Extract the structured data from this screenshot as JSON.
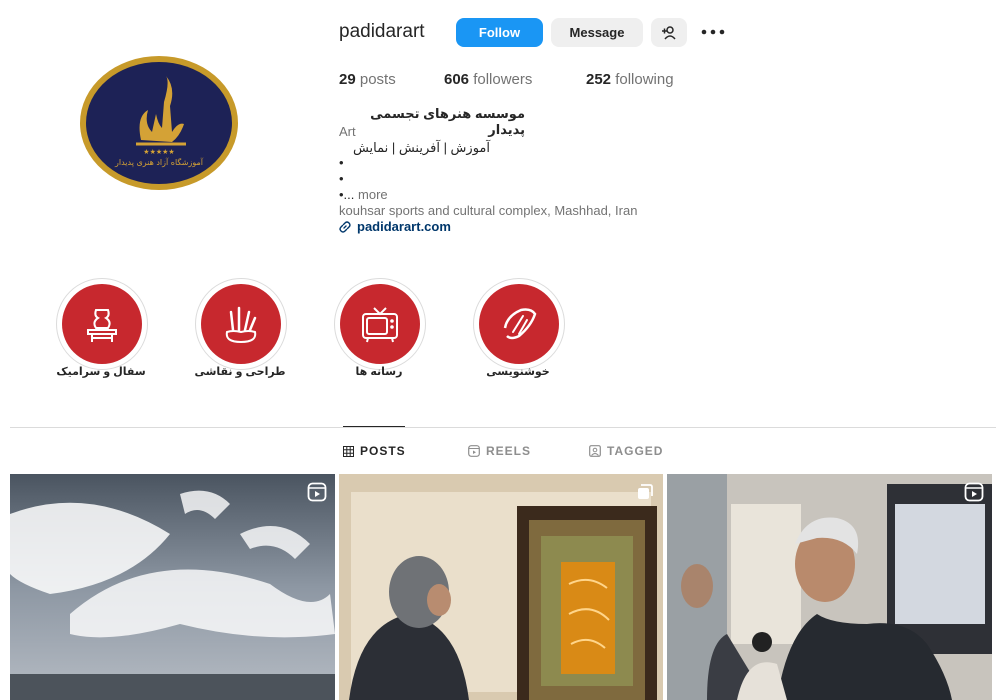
{
  "profile": {
    "username": "padidarart",
    "follow_label": "Follow",
    "message_label": "Message",
    "avatar_text": "آموزشگاه آزاد هنری پدیدار",
    "avatar_stars": "★★★★★"
  },
  "stats": {
    "posts_count": "29",
    "posts_label": "posts",
    "followers_count": "606",
    "followers_label": "followers",
    "following_count": "252",
    "following_label": "following"
  },
  "bio": {
    "name": "موسسه هنرهای تجسمی پدیدار",
    "category": "Art",
    "line": "آموزش | آفرینش | نمایش",
    "bullet1": "•",
    "bullet2": "•",
    "bullet3": "•...",
    "more": "more",
    "location": "kouhsar sports and cultural complex, Mashhad, Iran",
    "link": "padidarart.com"
  },
  "highlights": [
    {
      "label": "سفال و سرامیک",
      "icon": "pottery-icon"
    },
    {
      "label": "طراحی و نقاشی",
      "icon": "paint-brushes-icon"
    },
    {
      "label": "رسانه ها",
      "icon": "television-icon"
    },
    {
      "label": "خوشنویسی",
      "icon": "calligraphy-icon"
    }
  ],
  "tabs": [
    {
      "label": "POSTS",
      "icon": "grid-icon",
      "active": true
    },
    {
      "label": "REELS",
      "icon": "reels-icon",
      "active": false
    },
    {
      "label": "TAGGED",
      "icon": "tagged-icon",
      "active": false
    }
  ],
  "colors": {
    "follow": "#1a96f4",
    "highlight": "#c7282e",
    "avatar_bg": "#1d2256",
    "avatar_ring": "#c79a2a",
    "link": "#00376b"
  }
}
